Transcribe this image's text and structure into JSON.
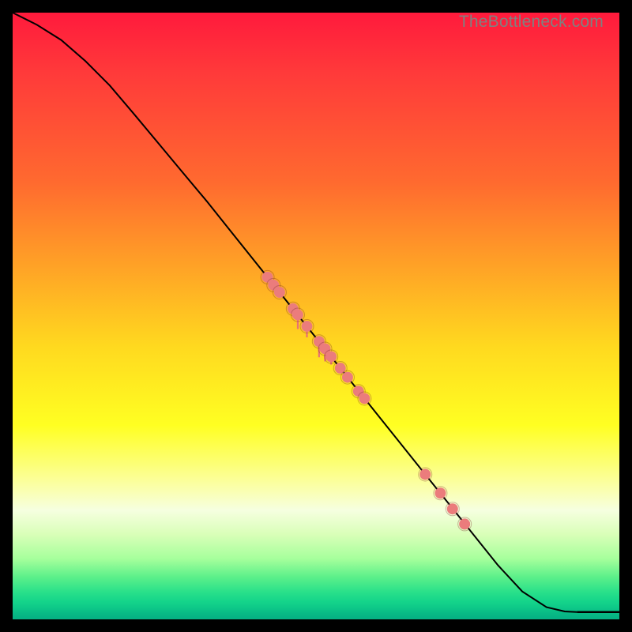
{
  "watermark": "TheBottleneck.com",
  "chart_data": {
    "type": "line",
    "title": "",
    "xlabel": "",
    "ylabel": "",
    "xlim": [
      0,
      100
    ],
    "ylim": [
      0,
      100
    ],
    "curve": {
      "x": [
        0,
        4,
        8,
        12,
        16,
        20,
        24,
        28,
        32,
        36,
        40,
        44,
        48,
        52,
        56,
        60,
        64,
        68,
        72,
        76,
        80,
        84,
        88,
        91,
        93
      ],
      "y": [
        100,
        98,
        95.5,
        92,
        88,
        83.3,
        78.5,
        73.7,
        68.9,
        63.9,
        58.9,
        53.9,
        48.9,
        43.9,
        38.9,
        33.9,
        28.9,
        23.9,
        18.9,
        13.9,
        8.9,
        4.6,
        2.0,
        1.3,
        1.2
      ]
    },
    "flat_tail": {
      "x0": 93,
      "x1": 100,
      "y": 1.2
    },
    "points": {
      "x": [
        42,
        43,
        44,
        46.2,
        47,
        48.5,
        50.5,
        51.5,
        52.5,
        54,
        55.2,
        57,
        58,
        68,
        70.5,
        72.5,
        74.5
      ],
      "y": [
        56.4,
        55.1,
        53.9,
        51.2,
        50.2,
        48.3,
        45.8,
        44.6,
        43.3,
        41.4,
        39.9,
        37.6,
        36.4,
        23.9,
        20.8,
        18.2,
        15.7
      ],
      "stem": [
        0,
        0,
        0,
        10,
        18,
        14,
        20,
        16,
        10,
        0,
        0,
        0,
        0,
        0,
        0,
        0,
        0
      ]
    },
    "colors": {
      "curve": "#000000",
      "points": "#eb7c7c",
      "background_top": "#ff1a3c",
      "background_bottom": "#05b083"
    }
  }
}
